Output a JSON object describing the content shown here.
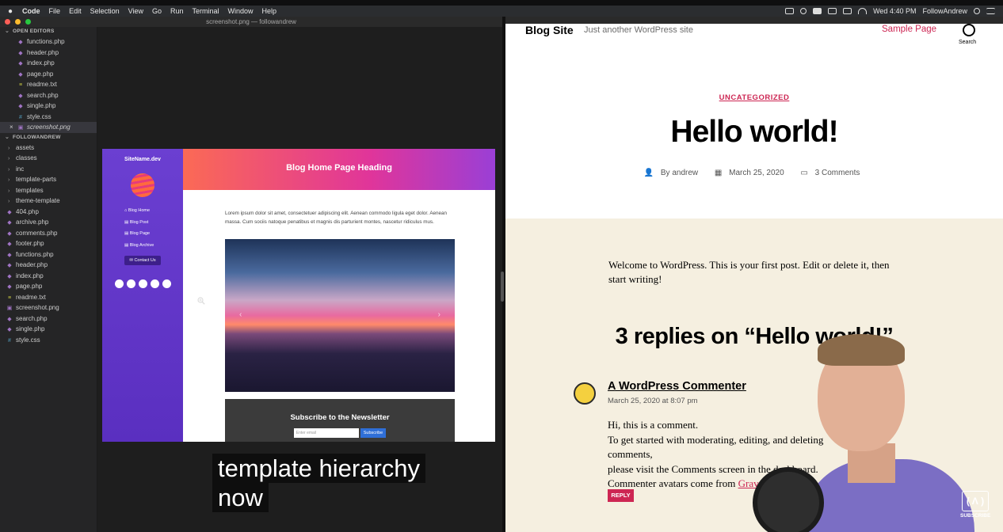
{
  "menubar": {
    "apple": "",
    "items": [
      "Code",
      "File",
      "Edit",
      "Selection",
      "View",
      "Go",
      "Run",
      "Terminal",
      "Window",
      "Help"
    ],
    "clock": "Wed 4:40 PM",
    "user": "FollowAndrew"
  },
  "vscode": {
    "title": "screenshot.png — followandrew",
    "open_editors_label": "OPEN EDITORS",
    "open_editors": [
      {
        "name": "functions.php",
        "type": "php"
      },
      {
        "name": "header.php",
        "type": "php"
      },
      {
        "name": "index.php",
        "type": "php"
      },
      {
        "name": "page.php",
        "type": "php"
      },
      {
        "name": "readme.txt",
        "type": "txt"
      },
      {
        "name": "search.php",
        "type": "php"
      },
      {
        "name": "single.php",
        "type": "php"
      },
      {
        "name": "style.css",
        "type": "css"
      },
      {
        "name": "screenshot.png",
        "type": "png",
        "active": true
      }
    ],
    "folder_label": "FOLLOWANDREW",
    "folders": [
      "assets",
      "classes",
      "inc",
      "template-parts",
      "templates",
      "theme-template"
    ],
    "files": [
      {
        "name": "404.php",
        "type": "php"
      },
      {
        "name": "archive.php",
        "type": "php"
      },
      {
        "name": "comments.php",
        "type": "php"
      },
      {
        "name": "footer.php",
        "type": "php"
      },
      {
        "name": "functions.php",
        "type": "php"
      },
      {
        "name": "header.php",
        "type": "php"
      },
      {
        "name": "index.php",
        "type": "php"
      },
      {
        "name": "page.php",
        "type": "php"
      },
      {
        "name": "readme.txt",
        "type": "txt"
      },
      {
        "name": "screenshot.png",
        "type": "png"
      },
      {
        "name": "search.php",
        "type": "php"
      },
      {
        "name": "single.php",
        "type": "php"
      },
      {
        "name": "style.css",
        "type": "css"
      }
    ]
  },
  "preview": {
    "site_name": "SiteName.dev",
    "nav": [
      "Blog Home",
      "Blog Post",
      "Blog Page",
      "Blog Archive"
    ],
    "contact": "Contact Us",
    "heading": "Blog Home Page Heading",
    "paragraph": "Lorem ipsum dolor sit amet, consectetuer adipiscing elit. Aenean commodo ligula eget dolor. Aenean massa. Cum sociis natoque penatibus et magnis dis parturient montes, nascetur ridiculus mus.",
    "newsletter_title": "Subscribe to the Newsletter",
    "email_placeholder": "Enter email",
    "subscribe_label": "Subscribe"
  },
  "caption": {
    "line1": "template hierarchy",
    "line2": "now"
  },
  "site": {
    "title": "Blog Site",
    "tagline": "Just another WordPress site",
    "nav_link": "Sample Page",
    "search_label": "Search",
    "category": "UNCATEGORIZED",
    "post_title": "Hello world!",
    "author": "By andrew",
    "date": "March 25, 2020",
    "comments_count": "3 Comments",
    "content": "Welcome to WordPress. This is your first post. Edit or delete it, then start writing!",
    "replies_heading": "3 replies on “Hello world!”",
    "comment": {
      "author": "A WordPress Commenter",
      "date": "March 25, 2020 at 8:07 pm",
      "line1": "Hi, this is a comment.",
      "line2": "To get started with moderating, editing, and deleting comments,",
      "line3": "please visit the Comments screen in the dashboard.",
      "line4_pre": "Commenter avatars come from ",
      "line4_link": "Gravatar",
      "line4_post": ".",
      "reply_label": "REPLY"
    }
  },
  "overlay": {
    "subscribe_logo": "( Λ )",
    "subscribe_label": "SUBSCRIBE"
  }
}
